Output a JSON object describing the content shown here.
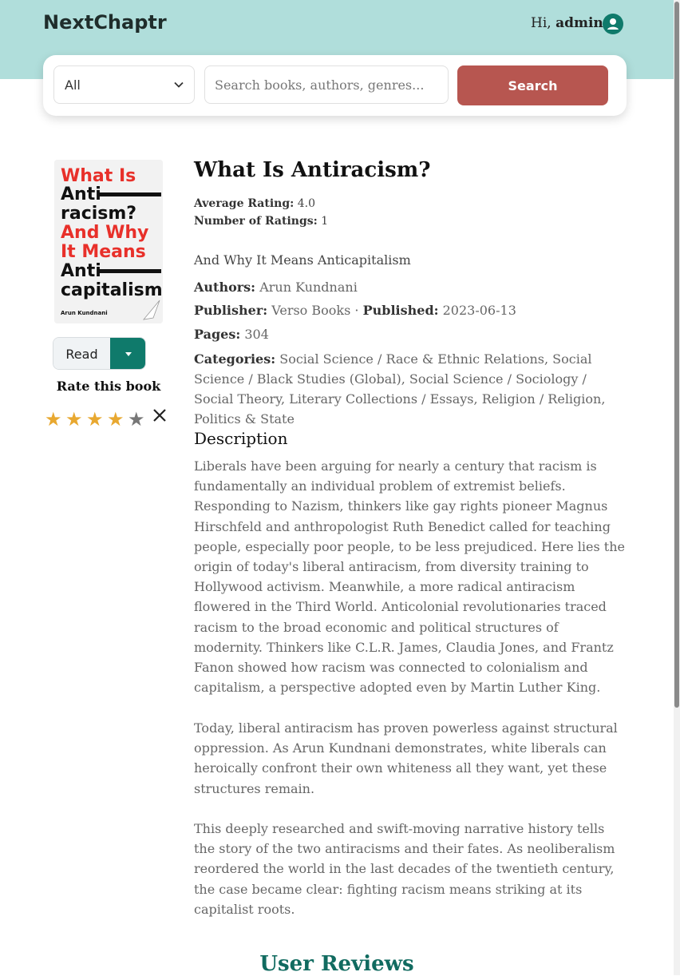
{
  "app": {
    "logo": "NextChaptr"
  },
  "user": {
    "greeting": "Hi,",
    "name": "admin"
  },
  "search": {
    "filter_selected": "All",
    "placeholder": "Search books, authors, genres...",
    "button_label": "Search"
  },
  "book": {
    "cover": {
      "lines": [
        "What Is",
        "Anti",
        "racism?",
        "And Why",
        "It Means",
        "Anti",
        "capitalism"
      ],
      "author": "Arun Kundnani"
    },
    "title": "What Is Antiracism?",
    "avg_rating_label": "Average Rating:",
    "avg_rating": "4.0",
    "num_ratings_label": "Number of Ratings:",
    "num_ratings": "1",
    "subtitle": "And Why It Means Anticapitalism",
    "authors_label": "Authors:",
    "authors": "Arun Kundnani",
    "publisher_label": "Publisher:",
    "publisher": "Verso Books",
    "separator": "·",
    "published_label": "Published:",
    "published": "2023-06-13",
    "pages_label": "Pages:",
    "pages": "304",
    "categories_label": "Categories:",
    "categories": "Social Science / Race & Ethnic Relations, Social Science / Black Studies (Global), Social Science / Sociology / Social Theory, Literary Collections / Essays, Religion / Religion, Politics & State"
  },
  "actions": {
    "read_label": "Read",
    "rate_label": "Rate this book",
    "user_rating": 4,
    "max_rating": 5
  },
  "description": {
    "heading": "Description",
    "paragraphs": [
      "Liberals have been arguing for nearly a century that racism is fundamentally an individual problem of extremist beliefs. Responding to Nazism, thinkers like gay rights pioneer Magnus Hirschfeld and anthropologist Ruth Benedict called for teaching people, especially poor people, to be less prejudiced. Here lies the origin of today's liberal antiracism, from diversity training to Hollywood activism. Meanwhile, a more radical antiracism flowered in the Third World. Anticolonial revolutionaries traced racism to the broad economic and political structures of modernity. Thinkers like C.L.R. James, Claudia Jones, and Frantz Fanon showed how racism was connected to colonialism and capitalism, a perspective adopted even by Martin Luther King.",
      "Today, liberal antiracism has proven powerless against structural oppression. As Arun Kundnani demonstrates, white liberals can heroically confront their own whiteness all they want, yet these structures remain.",
      "This deeply researched and swift-moving narrative history tells the story of the two antiracisms and their fates. As neoliberalism reordered the world in the last decades of the twentieth century, the case became clear: fighting racism means striking at its capitalist roots."
    ]
  },
  "reviews": {
    "heading": "User Reviews"
  },
  "colors": {
    "header_bg": "#b0dedb",
    "search_button": "#b75650",
    "accent_teal": "#0f7a6b",
    "star_filled": "#e8a830",
    "star_empty": "#777777",
    "reviews_heading": "#116b60"
  }
}
